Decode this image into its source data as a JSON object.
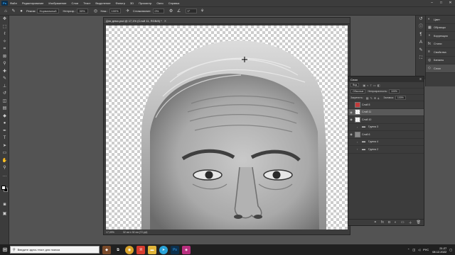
{
  "menu": {
    "logo": "Ps",
    "items": [
      "Файл",
      "Редактирование",
      "Изображение",
      "Слои",
      "Текст",
      "Выделение",
      "Фильтр",
      "3D",
      "Просмотр",
      "Окно",
      "Справка"
    ]
  },
  "options": {
    "mode_label": "Режим:",
    "mode_value": "Нормальный",
    "opacity_label": "Непрозр.:",
    "opacity_value": "30%",
    "flow_label": "Наж.:",
    "flow_value": "100%",
    "smooth_label": "Сглаживание:",
    "smooth_value": "0%",
    "angle_value": "0°"
  },
  "document": {
    "tab_title": "Для демо.psd @ 17,1% (Слой 11, RGB/8) *",
    "zoom": "17,09%",
    "info": "32 см x 32 см (72 ppi)"
  },
  "panel_nav": [
    "Цвет",
    "Образцы",
    "Коррекция",
    "Стили",
    "Свойства",
    "Каналы",
    "Слои"
  ],
  "layers": {
    "tab": "Слои",
    "filter_value": "Вид",
    "blend_value": "Обычные",
    "opacity_label": "Непрозрачность:",
    "opacity_value": "100%",
    "lock_label": "Закрепить:",
    "fill_label": "Заливка:",
    "fill_value": "100%",
    "items": [
      {
        "name": "Слой 5"
      },
      {
        "name": "Слой 11"
      },
      {
        "name": "Слой 10"
      },
      {
        "name": "Группа 3"
      },
      {
        "name": "Слой 6"
      },
      {
        "name": "Группа 4"
      },
      {
        "name": "Группа 2"
      }
    ]
  },
  "taskbar": {
    "search_placeholder": "Введите здесь текст для поиска",
    "lang": "РУС",
    "time": "21:27",
    "date": "08.12.2022"
  }
}
